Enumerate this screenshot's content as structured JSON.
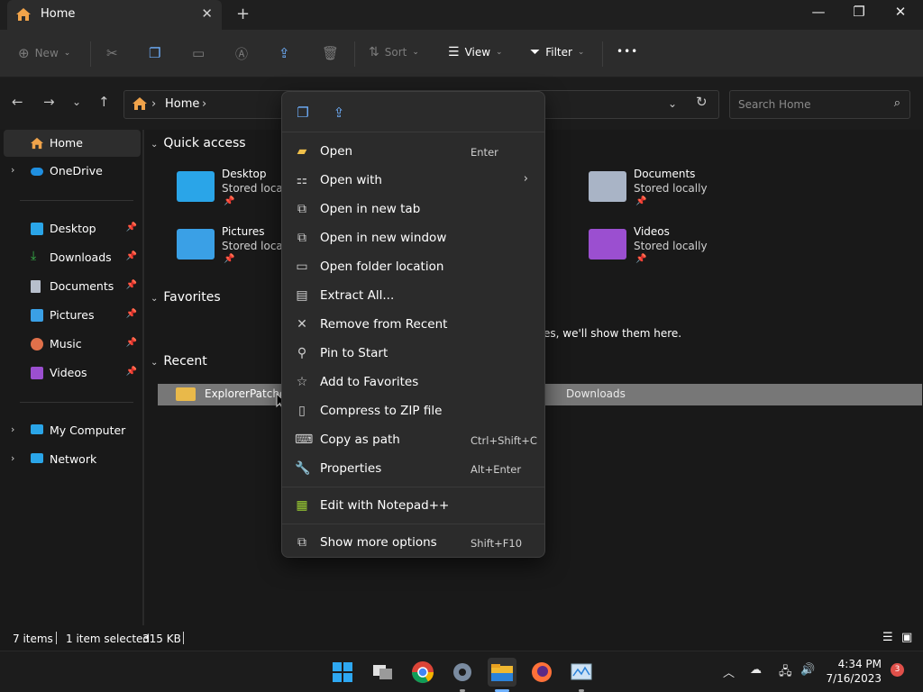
{
  "window": {
    "tab_title": "Home",
    "tab_close": "✕",
    "new_tab": "+",
    "min": "—",
    "max": "❐",
    "close": "✕"
  },
  "toolbar": {
    "new_label": "New",
    "sort_label": "Sort",
    "view_label": "View",
    "filter_label": "Filter",
    "more": "•••"
  },
  "address": {
    "crumbs": [
      "Home"
    ],
    "search_placeholder": "Search Home"
  },
  "sidebar": {
    "items": [
      {
        "label": "Home",
        "icon": "home-icon",
        "selected": true
      },
      {
        "label": "OneDrive",
        "icon": "cloud-icon"
      },
      {
        "label": "Desktop",
        "icon": "desktop-icon",
        "pinned": true
      },
      {
        "label": "Downloads",
        "icon": "download-icon",
        "pinned": true
      },
      {
        "label": "Documents",
        "icon": "document-icon",
        "pinned": true
      },
      {
        "label": "Pictures",
        "icon": "pictures-icon",
        "pinned": true
      },
      {
        "label": "Music",
        "icon": "music-icon",
        "pinned": true
      },
      {
        "label": "Videos",
        "icon": "videos-icon",
        "pinned": true
      },
      {
        "label": "My Computer",
        "icon": "computer-icon"
      },
      {
        "label": "Network",
        "icon": "network-icon"
      }
    ]
  },
  "main": {
    "quick_access_title": "Quick access",
    "favorites_title": "Favorites",
    "recent_title": "Recent",
    "favorites_empty": "es, we'll show them here.",
    "quick_access": [
      {
        "name": "Desktop",
        "sub": "Stored locall",
        "color": "#2aa5e8"
      },
      {
        "name": "Pictures",
        "sub": "Stored locall",
        "color": "#3aa0e6"
      },
      {
        "name": "Documents",
        "sub": "Stored locally",
        "color": "#a9b4c6"
      },
      {
        "name": "Videos",
        "sub": "Stored locally",
        "color": "#9b4fd0"
      }
    ],
    "recent": [
      {
        "name": "ExplorerPatche",
        "location": "Downloads"
      }
    ]
  },
  "context_menu": {
    "top_icons": [
      "copy-icon",
      "share-icon"
    ],
    "items": [
      {
        "label": "Open",
        "shortcut": "Enter",
        "icon": "open-folder-icon"
      },
      {
        "label": "Open with",
        "shortcut": "",
        "icon": "open-with-icon",
        "submenu": true
      },
      {
        "label": "Open in new tab",
        "shortcut": "",
        "icon": "new-tab-icon"
      },
      {
        "label": "Open in new window",
        "shortcut": "",
        "icon": "new-window-icon"
      },
      {
        "label": "Open folder location",
        "shortcut": "",
        "icon": "folder-location-icon"
      },
      {
        "label": "Extract All...",
        "shortcut": "",
        "icon": "extract-icon"
      },
      {
        "label": "Remove from Recent",
        "shortcut": "",
        "icon": "remove-icon"
      },
      {
        "label": "Pin to Start",
        "shortcut": "",
        "icon": "pin-icon"
      },
      {
        "label": "Add to Favorites",
        "shortcut": "",
        "icon": "star-icon"
      },
      {
        "label": "Compress to ZIP file",
        "shortcut": "",
        "icon": "zip-icon"
      },
      {
        "label": "Copy as path",
        "shortcut": "Ctrl+Shift+C",
        "icon": "copy-path-icon"
      },
      {
        "label": "Properties",
        "shortcut": "Alt+Enter",
        "icon": "properties-icon"
      },
      {
        "label": "Edit with Notepad++",
        "shortcut": "",
        "icon": "notepadpp-icon"
      },
      {
        "label": "Show more options",
        "shortcut": "Shift+F10",
        "icon": "more-options-icon"
      }
    ]
  },
  "status": {
    "items_count": "7 items",
    "selected": "1 item selected",
    "size": "315 KB"
  },
  "taskbar": {
    "time": "4:34 PM",
    "date": "7/16/2023",
    "notifications": "3"
  }
}
